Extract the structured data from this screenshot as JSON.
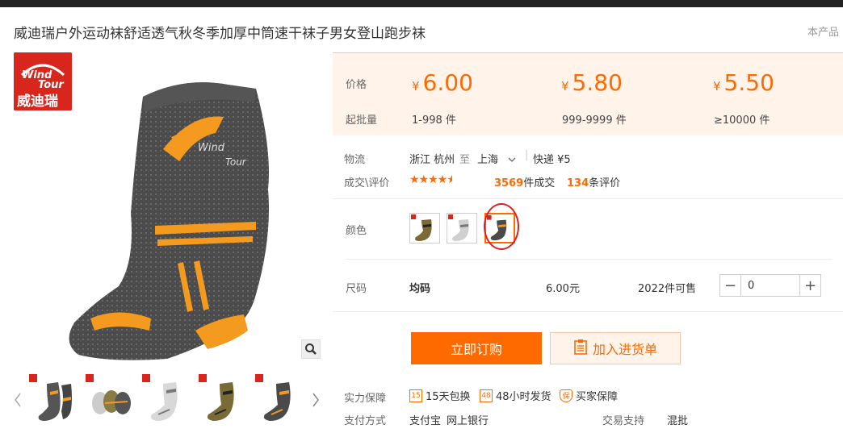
{
  "product": {
    "title": "威迪瑞户外运动袜舒适透气秋冬季加厚中筒速干袜子男女登山跑步袜",
    "report": "本产品"
  },
  "brand": {
    "line1": "Wind",
    "line2": "Tour",
    "cn": "威迪瑞"
  },
  "prices": {
    "price_label": "价格",
    "qty_label": "起批量",
    "currency": "¥",
    "tiers": [
      {
        "price": "6.00",
        "range": "1-998 件"
      },
      {
        "price": "5.80",
        "range": "999-9999 件"
      },
      {
        "price": "5.50",
        "range": "≥10000 件"
      }
    ]
  },
  "logistics": {
    "label": "物流",
    "from": "浙江 杭州",
    "to_word": "至",
    "dest": "上海",
    "express": "快递 ¥5"
  },
  "trade": {
    "label": "成交\\评价",
    "rating": 4.5,
    "deals": "3569",
    "deals_suffix": "件成交",
    "reviews": "134",
    "reviews_suffix": "条评价"
  },
  "color": {
    "label": "颜色",
    "selected_index": 2
  },
  "size": {
    "label": "尺码",
    "value": "均码",
    "unit_price": "6.00元",
    "stock": "2022件可售",
    "qty_value": "0"
  },
  "actions": {
    "buy": "立即订购",
    "cart": "加入进货单"
  },
  "guarantee": {
    "label": "实力保障",
    "items": [
      "15天包换",
      "48小时发货",
      "买家保障"
    ],
    "icons": [
      "15",
      "48",
      "保"
    ]
  },
  "payment": {
    "label": "支付方式",
    "methods": [
      "支付宝",
      "网上银行"
    ],
    "trade_label": "交易支持",
    "trade_value": "混批"
  },
  "colors": {
    "accent": "#ff6a00",
    "panel_bg": "#fff3ea",
    "brand_red": "#d9261c"
  }
}
